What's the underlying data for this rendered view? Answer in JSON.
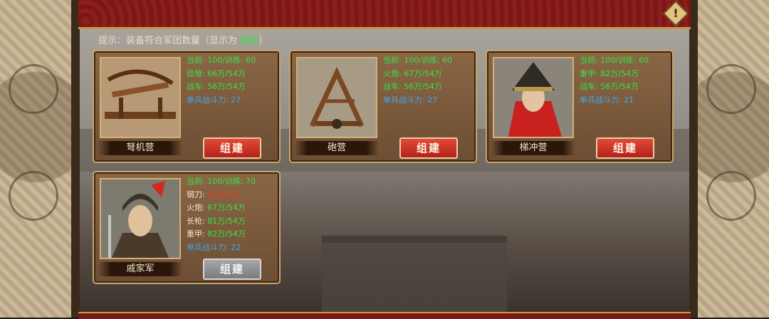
{
  "hint": {
    "prefix": "提示：装备符合军团数量（显示为 ",
    "highlight": "绿色",
    "suffix": "）"
  },
  "warning_icon": "warning-icon",
  "units": [
    {
      "name": "弩机营",
      "image": "crossbow-image",
      "stats": [
        {
          "label": "当前: 100/训练: 60",
          "style": "green"
        },
        {
          "label": "劲弩: 66万/54万",
          "style": "green"
        },
        {
          "label": "战车: 56万/54万",
          "style": "green"
        },
        {
          "label": "单兵战斗力: 27",
          "style": "blue"
        }
      ],
      "button": {
        "label": "组建",
        "state": "active"
      }
    },
    {
      "name": "砲营",
      "image": "catapult-image",
      "stats": [
        {
          "label": "当前: 100/训练: 60",
          "style": "green"
        },
        {
          "label": "火炮: 67万/54万",
          "style": "green"
        },
        {
          "label": "战车: 56万/54万",
          "style": "green"
        },
        {
          "label": "单兵战斗力: 27",
          "style": "blue"
        }
      ],
      "button": {
        "label": "组建",
        "state": "active"
      }
    },
    {
      "name": "梯冲营",
      "image": "armored-soldier-image",
      "stats": [
        {
          "label": "当前: 100/训练: 60",
          "style": "green"
        },
        {
          "label": "重甲: 82万/54万",
          "style": "green"
        },
        {
          "label": "战车: 56万/54万",
          "style": "green"
        },
        {
          "label": "单兵战斗力: 21",
          "style": "blue"
        }
      ],
      "button": {
        "label": "组建",
        "state": "active"
      }
    },
    {
      "name": "戚家军",
      "image": "general-portrait-image",
      "stats": [
        {
          "label": "当前: 100/训练: 70",
          "style": "green"
        },
        {
          "label_a": "钢刀: ",
          "label_b": "0万/54万",
          "style": "mixed-red"
        },
        {
          "label_a": "火炮: ",
          "label_b": "67万/54万",
          "style": "mixed-green"
        },
        {
          "label_a": "长枪: ",
          "label_b": "81万/54万",
          "style": "mixed-green"
        },
        {
          "label_a": "重甲: ",
          "label_b": "82万/54万",
          "style": "mixed-green"
        },
        {
          "label": "单兵战斗力: 22",
          "style": "blue"
        }
      ],
      "button": {
        "label": "组建",
        "state": "disabled"
      }
    }
  ]
}
